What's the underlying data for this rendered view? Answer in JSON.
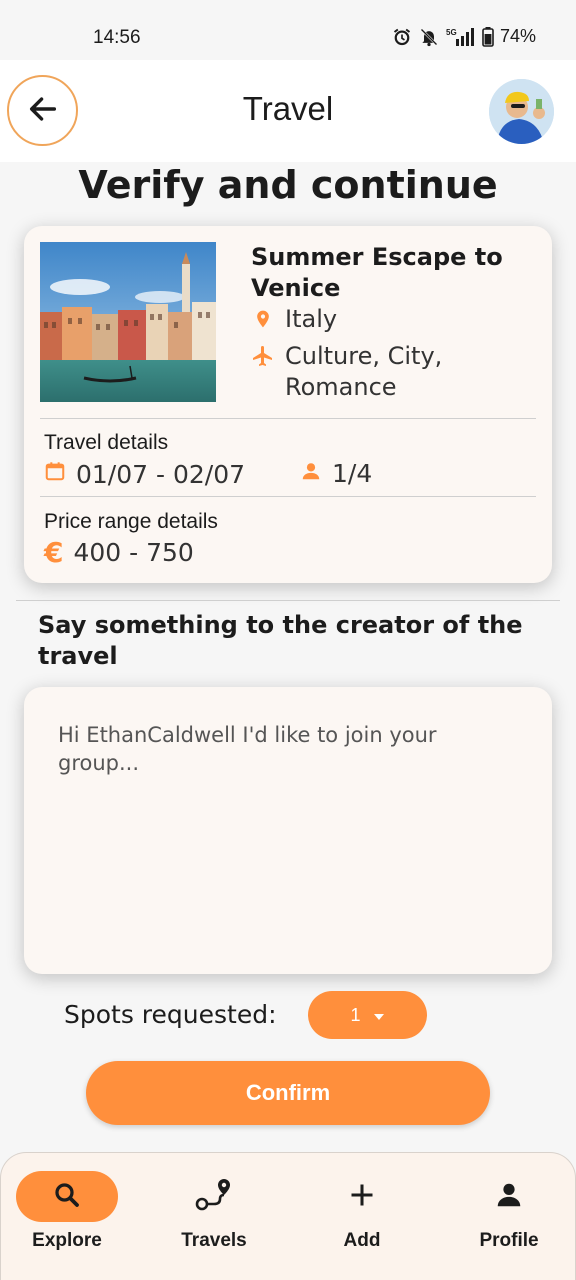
{
  "status_bar": {
    "time": "14:56",
    "network": "5G",
    "battery": "74%"
  },
  "app_bar": {
    "title": "Travel"
  },
  "page": {
    "title": "Verify and continue"
  },
  "travel_card": {
    "name": "Summer Escape to Venice",
    "country": "Italy",
    "categories": "Culture, City, Romance",
    "travel_details_label": "Travel details",
    "dates": "01/07 - 02/07",
    "participants": "1/4",
    "price_label": "Price range details",
    "price_range": "400 - 750"
  },
  "message": {
    "heading": "Say something to the creator of the travel",
    "placeholder": "Hi EthanCaldwell I'd like to join your group..."
  },
  "spots": {
    "label": "Spots requested:",
    "selected": "1"
  },
  "confirm_label": "Confirm",
  "bottom_nav": {
    "items": [
      {
        "label": "Explore",
        "icon": "search-icon",
        "active": true
      },
      {
        "label": "Travels",
        "icon": "route-icon",
        "active": false
      },
      {
        "label": "Add",
        "icon": "plus-icon",
        "active": false
      },
      {
        "label": "Profile",
        "icon": "person-icon",
        "active": false
      }
    ]
  },
  "colors": {
    "accent": "#ff8f3c",
    "card_bg": "#fcf7f3",
    "nav_bg": "#fcf3ec"
  }
}
